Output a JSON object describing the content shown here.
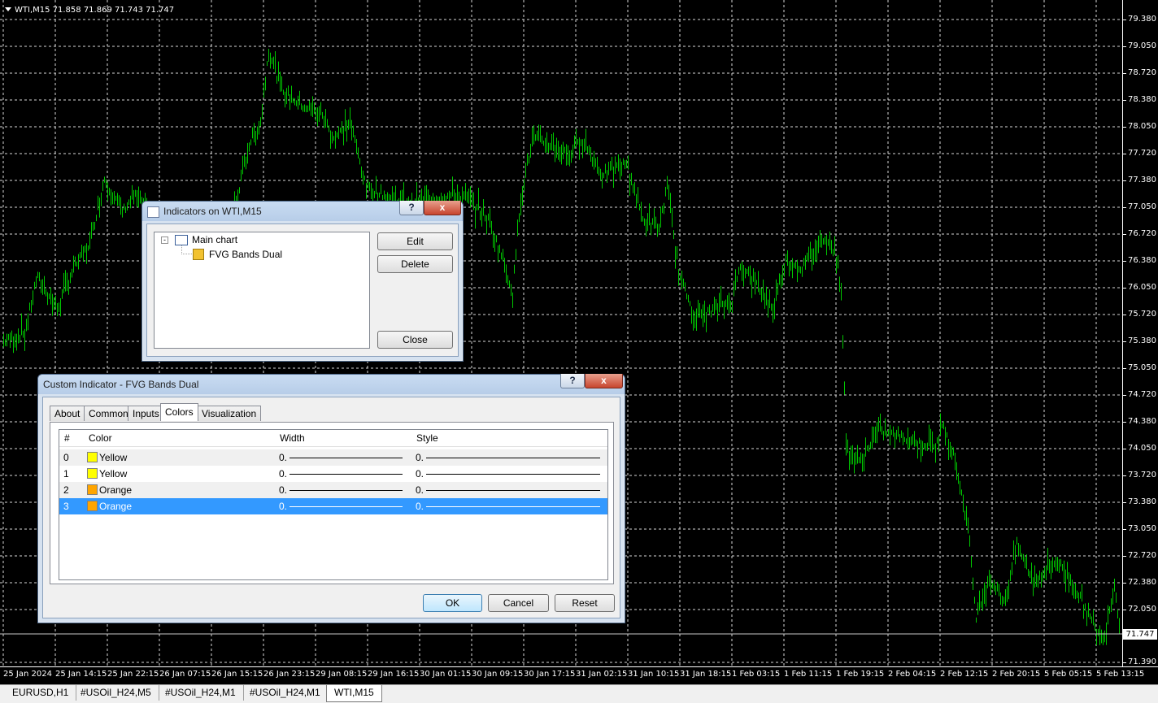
{
  "chart": {
    "symbol_header": "WTI,M15  71.858 71.869 71.743 71.747",
    "current_price": "71.747",
    "price_labels": [
      "79.380",
      "79.050",
      "78.720",
      "78.380",
      "78.050",
      "77.720",
      "77.380",
      "77.050",
      "76.720",
      "76.380",
      "76.050",
      "75.720",
      "75.380",
      "75.050",
      "74.720",
      "74.380",
      "74.050",
      "73.720",
      "73.380",
      "73.050",
      "72.720",
      "72.380",
      "72.050",
      "71.390"
    ],
    "time_labels": [
      "25 Jan 2024",
      "25 Jan 14:15",
      "25 Jan 22:15",
      "26 Jan 07:15",
      "26 Jan 15:15",
      "26 Jan 23:15",
      "29 Jan 08:15",
      "29 Jan 16:15",
      "30 Jan 01:15",
      "30 Jan 09:15",
      "30 Jan 17:15",
      "31 Jan 02:15",
      "31 Jan 10:15",
      "31 Jan 18:15",
      "1 Feb 03:15",
      "1 Feb 11:15",
      "1 Feb 19:15",
      "2 Feb 04:15",
      "2 Feb 12:15",
      "2 Feb 20:15",
      "5 Feb 05:15",
      "5 Feb 13:15"
    ],
    "bar_color": "#00c800",
    "grid_color": "#d8d8d8"
  },
  "tabs": [
    "EURUSD,H1",
    "#USOil_H24,M5",
    "#USOil_H24,M1",
    "#USOil_H24,M1",
    "WTI,M15"
  ],
  "indicators_dialog": {
    "title": "Indicators on WTI,M15",
    "help_label": "?",
    "close_label": "x",
    "tree_root": "Main chart",
    "tree_child": "FVG Bands Dual",
    "edit_label": "Edit",
    "delete_label": "Delete",
    "close_button_label": "Close"
  },
  "custom_dialog": {
    "title": "Custom Indicator - FVG Bands Dual",
    "help_label": "?",
    "close_label": "x",
    "tabs": [
      "About",
      "Common",
      "Inputs",
      "Colors",
      "Visualization"
    ],
    "active_tab": "Colors",
    "columns": [
      "#",
      "Color",
      "Width",
      "Style"
    ],
    "rows": [
      {
        "index": "0",
        "color_name": "Yellow",
        "color_hex": "#ffff00",
        "width": "0.",
        "style": "0."
      },
      {
        "index": "1",
        "color_name": "Yellow",
        "color_hex": "#ffff00",
        "width": "0.",
        "style": "0."
      },
      {
        "index": "2",
        "color_name": "Orange",
        "color_hex": "#ffa500",
        "width": "0.",
        "style": "0."
      },
      {
        "index": "3",
        "color_name": "Orange",
        "color_hex": "#ffa500",
        "width": "0.",
        "style": "0."
      }
    ],
    "ok_label": "OK",
    "cancel_label": "Cancel",
    "reset_label": "Reset"
  }
}
